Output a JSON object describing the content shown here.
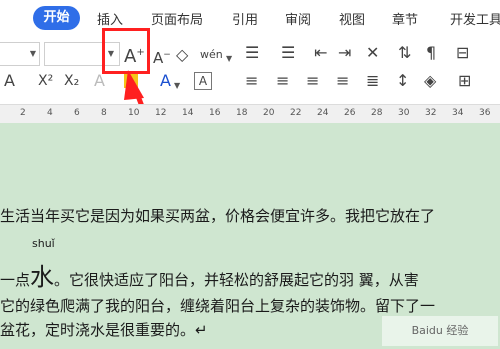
{
  "tabs": {
    "start": "开始",
    "insert": "插入",
    "layout": "页面布局",
    "reference": "引用",
    "review": "审阅",
    "view": "视图",
    "section": "章节",
    "developer": "开发工具"
  },
  "ribbon": {
    "grow_font": "A",
    "grow_font_sup": "+",
    "shrink_font": "A",
    "shrink_font_sup": "−",
    "clear_format": "◇",
    "phonetic": "wén",
    "superscript": "X²",
    "subscript": "X₂",
    "font_color": "A",
    "char_shade": "A",
    "text_effect": "A"
  },
  "ruler": {
    "marks": [
      "2",
      "4",
      "6",
      "8",
      "10",
      "12",
      "14",
      "16",
      "18",
      "20",
      "22",
      "24",
      "26",
      "28",
      "30",
      "32",
      "34",
      "36"
    ]
  },
  "document": {
    "line1": "生活当年买它是因为如果买两盆，价格会便宜许多。我把它放在了",
    "pinyin": "shuǐ",
    "line2_prefix": "一点",
    "line2_big": "水",
    "line2_rest": "。它很快适应了阳台，并轻松的舒展起它的羽 翼，从害",
    "line3": "它的绿色爬满了我的阳台，缠绕着阳台上复杂的装饰物。留下了一",
    "line4": "盆花，定时浇水是很重要的。↵"
  },
  "watermark": "Baidu 经验",
  "colors": {
    "accent": "#2f6ee8",
    "annotation": "#ff2020",
    "doc_background": "#cfe6d0"
  }
}
